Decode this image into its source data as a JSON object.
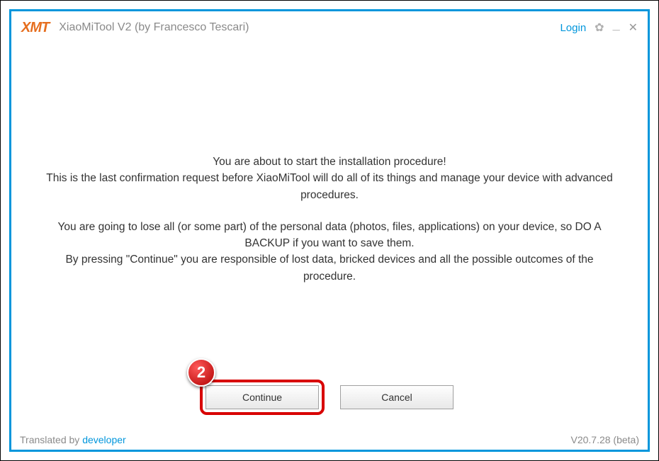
{
  "header": {
    "logo": "XMT",
    "title": "XiaoMiTool V2 (by Francesco Tescari)",
    "login": "Login"
  },
  "content": {
    "paragraph1": "You are about to start the installation procedure!\nThis is the last confirmation request before XiaoMiTool will do all of its things and manage your device with advanced procedures.",
    "paragraph2": "You are going to lose all (or some part) of the personal data (photos, files, applications) on your device, so DO A BACKUP if you want to save them.\nBy pressing \"Continue\" you are responsible of lost data, bricked devices and all the possible outcomes of the procedure."
  },
  "buttons": {
    "continue": "Continue",
    "cancel": "Cancel"
  },
  "annotation": {
    "step": "2"
  },
  "footer": {
    "translated_by": "Translated by ",
    "developer": "developer",
    "version": "V20.7.28 (beta)"
  }
}
